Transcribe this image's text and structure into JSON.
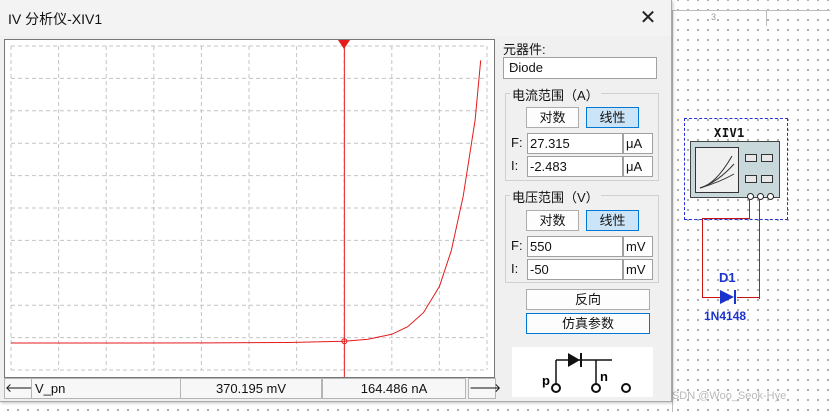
{
  "window": {
    "title": "IV 分析仪-XIV1",
    "close_glyph": "✕"
  },
  "panel": {
    "component_label": "元器件:",
    "component_value": "Diode",
    "current_range": {
      "title": "电流范围（A）",
      "log_label": "对数",
      "linear_label": "线性",
      "f_label": "F:",
      "f_value": "27.315",
      "f_unit": "μA",
      "i_label": "I:",
      "i_value": "-2.483",
      "i_unit": "μA"
    },
    "voltage_range": {
      "title": "电压范围（V）",
      "log_label": "对数",
      "linear_label": "线性",
      "f_label": "F:",
      "f_value": "550",
      "f_unit": "mV",
      "i_label": "I:",
      "i_value": "-50",
      "i_unit": "mV"
    },
    "reverse_button": "反向",
    "sim_params_button": "仿真参数"
  },
  "statusbar": {
    "left_arrow": "🡐",
    "trace_name": "V_pn",
    "voltage": "370.195 mV",
    "current": "164.486 nA",
    "right_arrow": "🡒"
  },
  "schematic": {
    "instrument_label": "XIV1",
    "diode_ref": "D1",
    "diode_part": "1N4148",
    "terminal_p": "p",
    "terminal_n": "n",
    "ruler_mark": "3"
  },
  "watermark": "CSDN @Woo_Seok-Hye",
  "colors": {
    "trace": "#e31b1b",
    "schematic_blue": "#1a33cc",
    "active_toggle": "#cce4f7"
  },
  "chart_data": {
    "type": "line",
    "x_range_mV": [
      -50,
      550
    ],
    "y_range_uA": [
      -2.483,
      27.315
    ],
    "grid": true,
    "cursor_x_mV": 370.195,
    "series": [
      {
        "x": [
          -50,
          0,
          100,
          200,
          300,
          370.195,
          400,
          430,
          450,
          470,
          490,
          505,
          520,
          535,
          542
        ],
        "y": [
          0,
          0,
          0.002,
          0.01,
          0.05,
          0.164,
          0.35,
          0.8,
          1.5,
          2.8,
          5.2,
          8.5,
          13.5,
          20.5,
          26.0
        ]
      }
    ]
  }
}
